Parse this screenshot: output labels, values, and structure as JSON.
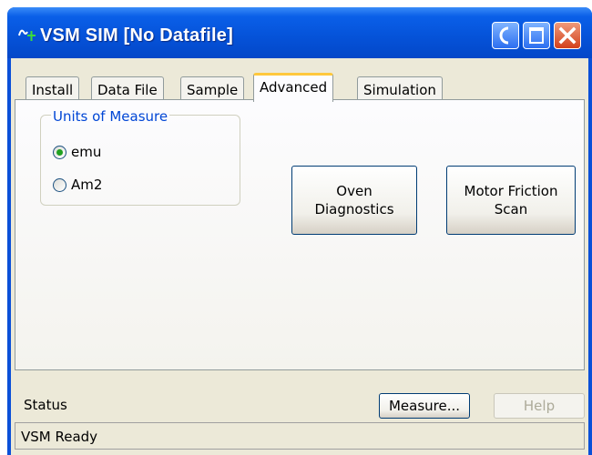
{
  "window": {
    "title": "VSM SIM [No Datafile]"
  },
  "tabs": [
    {
      "label": "Install",
      "active": false
    },
    {
      "label": "Data File",
      "active": false
    },
    {
      "label": "Sample",
      "active": false
    },
    {
      "label": "Advanced",
      "active": true
    },
    {
      "label": "Simulation",
      "active": false
    }
  ],
  "advanced": {
    "units_group_label": "Units of Measure",
    "units_options": [
      {
        "label": "emu",
        "selected": true
      },
      {
        "label": "Am2",
        "selected": false
      }
    ],
    "oven_button_line1": "Oven",
    "oven_button_line2": "Diagnostics",
    "motor_button_line1": "Motor Friction",
    "motor_button_line2": "Scan"
  },
  "footer": {
    "status_label": "Status",
    "measure_button": "Measure...",
    "help_button": "Help",
    "status_text": "VSM Ready"
  },
  "icons": {
    "app": "probe-icon",
    "minimize": "minimize-icon",
    "maximize": "maximize-icon",
    "close": "close-icon"
  },
  "colors": {
    "titlebar": "#0552d8",
    "active_tab_accent": "#ffc83c",
    "group_label": "#0046d5",
    "radio_selected": "#21a121",
    "close_button": "#d2401c"
  }
}
